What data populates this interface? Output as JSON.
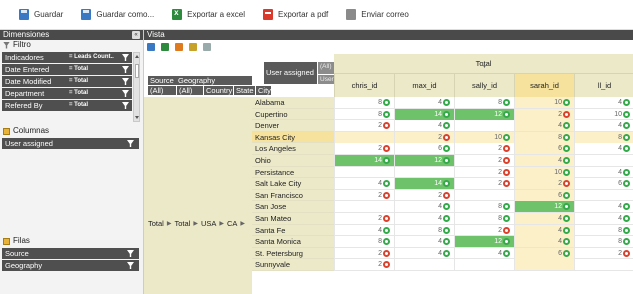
{
  "toolbar": {
    "save": "Guardar",
    "save_as": "Guardar como...",
    "export_excel": "Exportar a excel",
    "export_pdf": "Exportar a pdf",
    "send_mail": "Enviar correo"
  },
  "left_panel": {
    "title": "Dimensiones",
    "collapse_label": "«",
    "filter_title": "Filtro",
    "filters": [
      {
        "name": "Indicadores",
        "value": "= Leads Count.."
      },
      {
        "name": "Date Entered",
        "value": "= Total"
      },
      {
        "name": "Date Modified",
        "value": "= Total"
      },
      {
        "name": "Department",
        "value": "= Total"
      },
      {
        "name": "Refered By",
        "value": "= Total"
      }
    ],
    "columns_title": "Columnas",
    "columns": [
      "User assigned"
    ],
    "rows_title": "Filas",
    "rows": [
      "Source",
      "Geography"
    ]
  },
  "view": {
    "title": "Vista",
    "corner": {
      "user_assigned": "User assigned",
      "user": "User",
      "all_top": "(All)",
      "source": "Source",
      "geography": "Geography",
      "all1": "(All)",
      "all2": "(All)",
      "country": "Country",
      "state": "State",
      "city": "City"
    },
    "total_label": "Total",
    "hierarchy": [
      "Total",
      "Total",
      "USA",
      "CA"
    ],
    "columns": [
      "chris_id",
      "max_id",
      "sally_id",
      "sarah_id",
      "ll_id"
    ],
    "highlight_column": 3,
    "highlight_row": 3,
    "cities": [
      "Alabama",
      "Cupertino",
      "Denver",
      "Kansas City",
      "Los Angeles",
      "Ohio",
      "Persistance",
      "Salt Lake City",
      "San Francisco",
      "San Jose",
      "San Mateo",
      "Santa Fe",
      "Santa Monica",
      "St. Petersburg",
      "Sunnyvale"
    ],
    "rows": [
      [
        {
          "v": "8",
          "m": "up"
        },
        {
          "v": "4",
          "m": "up"
        },
        {
          "v": "8",
          "m": "up"
        },
        {
          "v": "10",
          "m": "up"
        },
        {
          "v": "4",
          "m": "up"
        }
      ],
      [
        {
          "v": "8",
          "m": "up"
        },
        {
          "v": "14",
          "m": "up",
          "g": 1
        },
        {
          "v": "12",
          "m": "up",
          "g": 1
        },
        {
          "v": "2",
          "m": "dn"
        },
        {
          "v": "10",
          "m": "up"
        }
      ],
      [
        {
          "v": "2",
          "m": "dn"
        },
        {
          "v": "4",
          "m": "up"
        },
        {
          "v": "",
          "m": ""
        },
        {
          "v": "4",
          "m": "up"
        },
        {
          "v": "4",
          "m": "up"
        }
      ],
      [
        {
          "v": "",
          "m": ""
        },
        {
          "v": "2",
          "m": "dn"
        },
        {
          "v": "10",
          "m": "up"
        },
        {
          "v": "8",
          "m": "up"
        },
        {
          "v": "8",
          "m": "up"
        }
      ],
      [
        {
          "v": "2",
          "m": "dn"
        },
        {
          "v": "6",
          "m": "up"
        },
        {
          "v": "2",
          "m": "dn"
        },
        {
          "v": "6",
          "m": "up"
        },
        {
          "v": "4",
          "m": "up"
        }
      ],
      [
        {
          "v": "14",
          "m": "up",
          "g": 1
        },
        {
          "v": "12",
          "m": "up",
          "g": 1
        },
        {
          "v": "2",
          "m": "dn"
        },
        {
          "v": "4",
          "m": "up"
        },
        {
          "v": "",
          "m": ""
        }
      ],
      [
        {
          "v": "",
          "m": ""
        },
        {
          "v": "",
          "m": ""
        },
        {
          "v": "2",
          "m": "dn"
        },
        {
          "v": "10",
          "m": "up"
        },
        {
          "v": "4",
          "m": "up"
        }
      ],
      [
        {
          "v": "4",
          "m": "up"
        },
        {
          "v": "14",
          "m": "up",
          "g": 1
        },
        {
          "v": "2",
          "m": "dn"
        },
        {
          "v": "2",
          "m": "dn"
        },
        {
          "v": "6",
          "m": "up"
        }
      ],
      [
        {
          "v": "2",
          "m": "dn"
        },
        {
          "v": "2",
          "m": "dn"
        },
        {
          "v": "",
          "m": ""
        },
        {
          "v": "6",
          "m": "up"
        },
        {
          "v": "",
          "m": ""
        }
      ],
      [
        {
          "v": "",
          "m": ""
        },
        {
          "v": "4",
          "m": "up"
        },
        {
          "v": "8",
          "m": "up"
        },
        {
          "v": "12",
          "m": "up",
          "g": 1
        },
        {
          "v": "4",
          "m": "up"
        }
      ],
      [
        {
          "v": "2",
          "m": "dn"
        },
        {
          "v": "4",
          "m": "up"
        },
        {
          "v": "8",
          "m": "up"
        },
        {
          "v": "4",
          "m": "up"
        },
        {
          "v": "4",
          "m": "up"
        }
      ],
      [
        {
          "v": "4",
          "m": "up"
        },
        {
          "v": "8",
          "m": "up"
        },
        {
          "v": "2",
          "m": "dn"
        },
        {
          "v": "4",
          "m": "up"
        },
        {
          "v": "8",
          "m": "up"
        }
      ],
      [
        {
          "v": "8",
          "m": "up"
        },
        {
          "v": "4",
          "m": "up"
        },
        {
          "v": "12",
          "m": "up",
          "g": 1
        },
        {
          "v": "4",
          "m": "up"
        },
        {
          "v": "8",
          "m": "up"
        }
      ],
      [
        {
          "v": "2",
          "m": "dn"
        },
        {
          "v": "4",
          "m": "up"
        },
        {
          "v": "4",
          "m": "up"
        },
        {
          "v": "6",
          "m": "up"
        },
        {
          "v": "2",
          "m": "dn"
        }
      ],
      [
        {
          "v": "2",
          "m": "dn"
        },
        {
          "v": "",
          "m": ""
        },
        {
          "v": "",
          "m": ""
        },
        {
          "v": "",
          "m": ""
        },
        {
          "v": "",
          "m": ""
        }
      ]
    ]
  }
}
